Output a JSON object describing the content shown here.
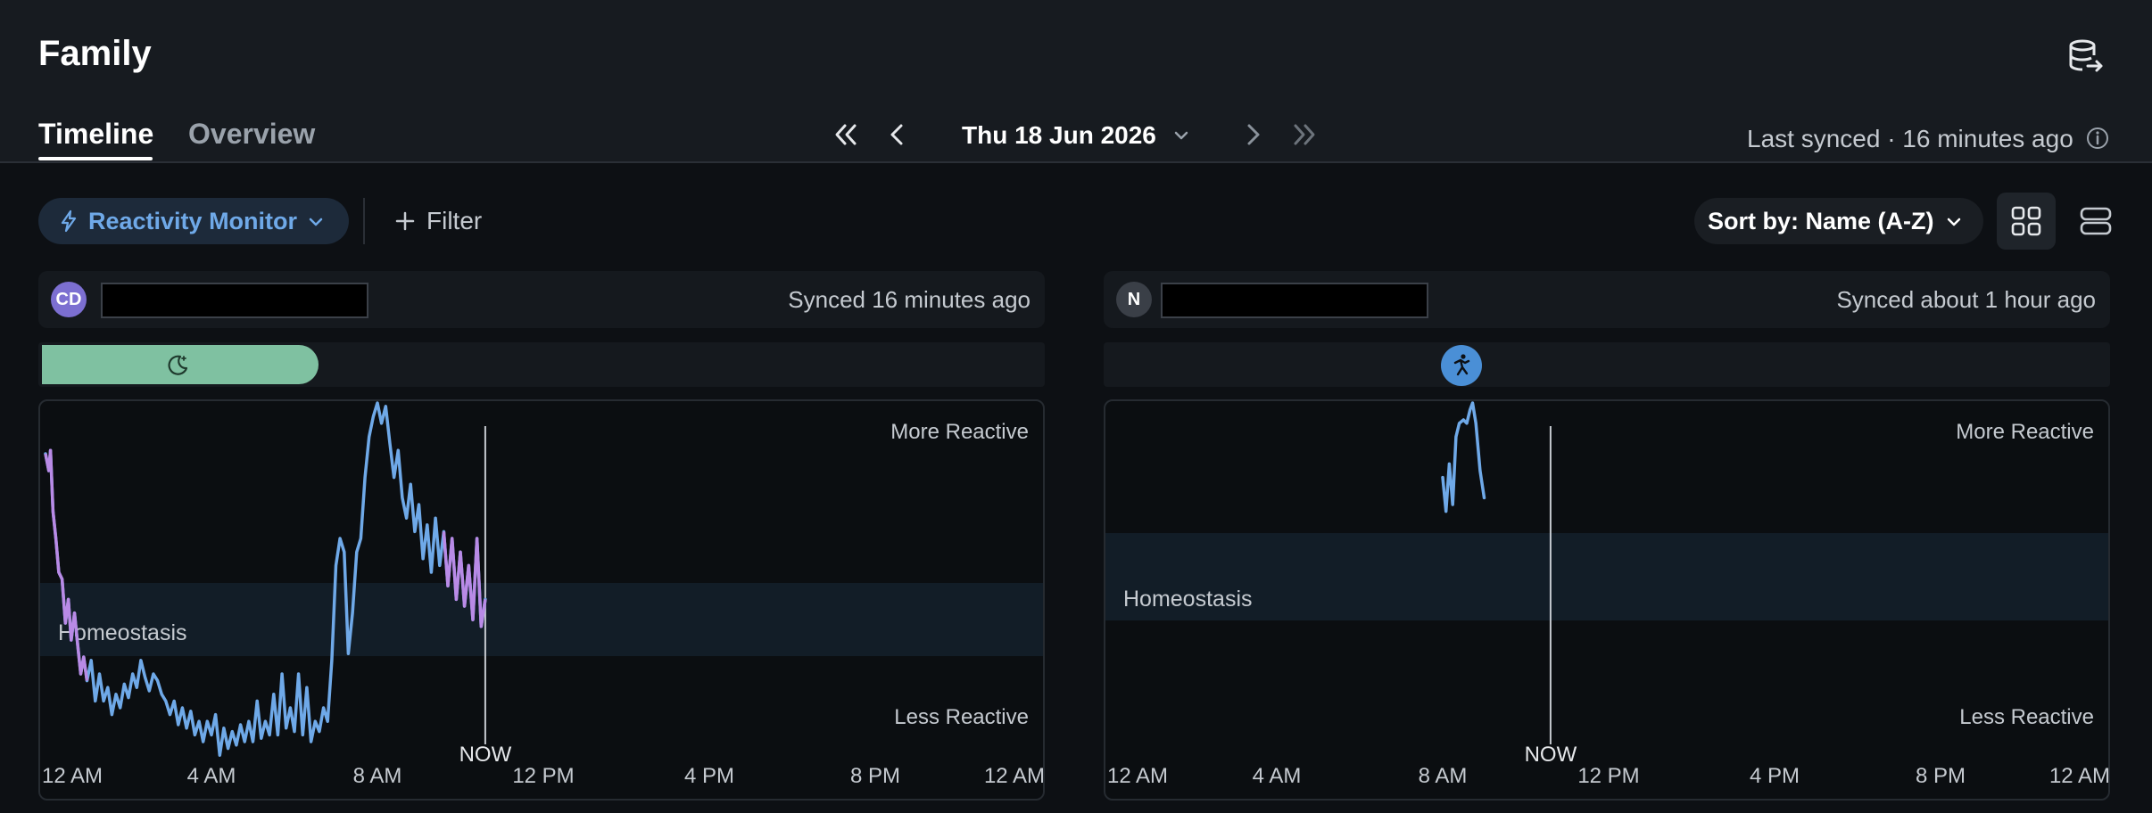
{
  "header": {
    "title": "Family",
    "tabs": [
      {
        "label": "Timeline",
        "active": true
      },
      {
        "label": "Overview",
        "active": false
      }
    ],
    "date": "Thu 18 Jun 2026",
    "last_synced": "Last synced · 16 minutes ago",
    "icons": {
      "database": "database-sync-icon",
      "first": "double-chevron-left-icon",
      "prev": "chevron-left-icon",
      "next": "chevron-right-icon",
      "last": "double-chevron-right-icon",
      "info": "info-icon"
    }
  },
  "toolbar": {
    "monitor_label": "Reactivity Monitor",
    "filter_label": "Filter",
    "sort_label": "Sort by: Name (A-Z)",
    "accent": "#6fa9e8"
  },
  "cards": [
    {
      "initials": "CD",
      "avatar_color": "#7c6fd1",
      "synced": "Synced 16 minutes ago",
      "activity": {
        "type": "sleep",
        "start_hour": 0,
        "end_hour": 6.6,
        "color": "#7fc1a1",
        "icon": "moon-star-icon"
      },
      "labels": {
        "top": "More Reactive",
        "bottom": "Less Reactive",
        "band": "Homeostasis",
        "now": "NOW"
      },
      "x_ticks": [
        "12 AM",
        "4 AM",
        "8 AM",
        "12 PM",
        "4 PM",
        "8 PM",
        "12 AM"
      ],
      "now_hour": 10.6,
      "series": [
        [
          0.0,
          0.95
        ],
        [
          0.08,
          0.9
        ],
        [
          0.12,
          0.96
        ],
        [
          0.18,
          0.78
        ],
        [
          0.25,
          0.7
        ],
        [
          0.32,
          0.6
        ],
        [
          0.4,
          0.58
        ],
        [
          0.48,
          0.45
        ],
        [
          0.55,
          0.52
        ],
        [
          0.62,
          0.4
        ],
        [
          0.7,
          0.48
        ],
        [
          0.78,
          0.38
        ],
        [
          0.85,
          0.3
        ],
        [
          0.92,
          0.35
        ],
        [
          1.0,
          0.28
        ],
        [
          1.1,
          0.34
        ],
        [
          1.2,
          0.22
        ],
        [
          1.3,
          0.3
        ],
        [
          1.4,
          0.22
        ],
        [
          1.5,
          0.26
        ],
        [
          1.6,
          0.18
        ],
        [
          1.7,
          0.24
        ],
        [
          1.8,
          0.2
        ],
        [
          1.9,
          0.27
        ],
        [
          2.0,
          0.23
        ],
        [
          2.1,
          0.3
        ],
        [
          2.2,
          0.26
        ],
        [
          2.3,
          0.34
        ],
        [
          2.4,
          0.29
        ],
        [
          2.5,
          0.25
        ],
        [
          2.6,
          0.3
        ],
        [
          2.7,
          0.28
        ],
        [
          2.8,
          0.24
        ],
        [
          2.9,
          0.22
        ],
        [
          3.0,
          0.18
        ],
        [
          3.1,
          0.22
        ],
        [
          3.2,
          0.15
        ],
        [
          3.3,
          0.2
        ],
        [
          3.4,
          0.14
        ],
        [
          3.5,
          0.19
        ],
        [
          3.6,
          0.12
        ],
        [
          3.7,
          0.16
        ],
        [
          3.8,
          0.1
        ],
        [
          3.9,
          0.16
        ],
        [
          4.0,
          0.12
        ],
        [
          4.1,
          0.18
        ],
        [
          4.2,
          0.06
        ],
        [
          4.3,
          0.14
        ],
        [
          4.4,
          0.08
        ],
        [
          4.5,
          0.13
        ],
        [
          4.6,
          0.09
        ],
        [
          4.7,
          0.15
        ],
        [
          4.8,
          0.1
        ],
        [
          4.9,
          0.16
        ],
        [
          5.0,
          0.1
        ],
        [
          5.1,
          0.22
        ],
        [
          5.2,
          0.11
        ],
        [
          5.3,
          0.16
        ],
        [
          5.4,
          0.12
        ],
        [
          5.5,
          0.24
        ],
        [
          5.6,
          0.12
        ],
        [
          5.7,
          0.3
        ],
        [
          5.8,
          0.14
        ],
        [
          5.9,
          0.2
        ],
        [
          6.0,
          0.13
        ],
        [
          6.1,
          0.3
        ],
        [
          6.2,
          0.12
        ],
        [
          6.3,
          0.26
        ],
        [
          6.4,
          0.1
        ],
        [
          6.5,
          0.16
        ],
        [
          6.6,
          0.13
        ],
        [
          6.7,
          0.2
        ],
        [
          6.8,
          0.16
        ],
        [
          6.9,
          0.34
        ],
        [
          7.0,
          0.62
        ],
        [
          7.1,
          0.7
        ],
        [
          7.2,
          0.66
        ],
        [
          7.3,
          0.36
        ],
        [
          7.4,
          0.48
        ],
        [
          7.5,
          0.66
        ],
        [
          7.6,
          0.7
        ],
        [
          7.7,
          0.88
        ],
        [
          7.8,
          1.0
        ],
        [
          7.9,
          1.06
        ],
        [
          8.0,
          1.1
        ],
        [
          8.1,
          1.04
        ],
        [
          8.2,
          1.09
        ],
        [
          8.3,
          0.98
        ],
        [
          8.4,
          0.88
        ],
        [
          8.5,
          0.96
        ],
        [
          8.6,
          0.82
        ],
        [
          8.7,
          0.76
        ],
        [
          8.8,
          0.86
        ],
        [
          8.9,
          0.72
        ],
        [
          9.0,
          0.8
        ],
        [
          9.1,
          0.64
        ],
        [
          9.2,
          0.74
        ],
        [
          9.3,
          0.6
        ],
        [
          9.4,
          0.76
        ],
        [
          9.5,
          0.62
        ],
        [
          9.6,
          0.72
        ],
        [
          9.7,
          0.56
        ],
        [
          9.8,
          0.7
        ],
        [
          9.9,
          0.52
        ],
        [
          10.0,
          0.66
        ],
        [
          10.1,
          0.5
        ],
        [
          10.2,
          0.62
        ],
        [
          10.3,
          0.46
        ],
        [
          10.4,
          0.7
        ],
        [
          10.5,
          0.44
        ],
        [
          10.6,
          0.52
        ]
      ]
    },
    {
      "initials": "N",
      "avatar_color": "#3a3f47",
      "synced": "Synced about 1 hour ago",
      "activity": {
        "type": "exercise",
        "hour": 8.5,
        "color": "#4a8fd6",
        "icon": "running-person-icon"
      },
      "labels": {
        "top": "More Reactive",
        "bottom": "Less Reactive",
        "band": "Homeostasis",
        "now": "NOW"
      },
      "x_ticks": [
        "12 AM",
        "4 AM",
        "8 AM",
        "12 PM",
        "4 PM",
        "8 PM",
        "12 AM"
      ],
      "now_hour": 10.6,
      "series": [
        [
          8.0,
          0.88
        ],
        [
          8.08,
          0.78
        ],
        [
          8.16,
          0.92
        ],
        [
          8.24,
          0.8
        ],
        [
          8.32,
          1.0
        ],
        [
          8.4,
          1.04
        ],
        [
          8.5,
          1.05
        ],
        [
          8.58,
          1.04
        ],
        [
          8.66,
          1.08
        ],
        [
          8.72,
          1.1
        ],
        [
          8.8,
          1.04
        ],
        [
          8.9,
          0.9
        ],
        [
          9.0,
          0.82
        ]
      ]
    }
  ]
}
